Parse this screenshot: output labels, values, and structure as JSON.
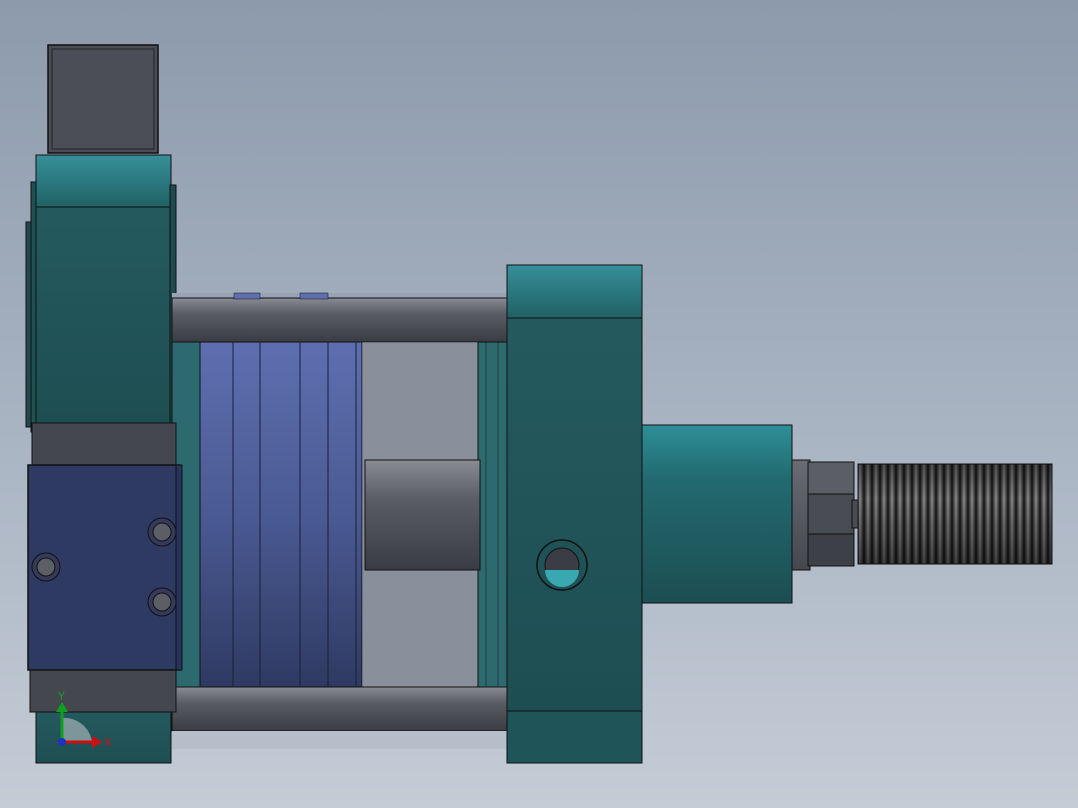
{
  "viewport": {
    "background_top": "#8d9aab",
    "background_bottom": "#c4ccd6",
    "view": "front"
  },
  "model": {
    "description_colors": {
      "body_teal": "#1f5558",
      "body_teal_light": "#2b7f86",
      "rod_gray": "#55575e",
      "barrel_blue": "#4d5f9a",
      "valve_navy": "#2e3a62",
      "thread_dark": "#1a1a1a"
    }
  },
  "triad": {
    "x_label": "X",
    "y_label": "Y",
    "x_color": "#d01010",
    "y_color": "#10a020",
    "z_color": "#2030c0"
  }
}
